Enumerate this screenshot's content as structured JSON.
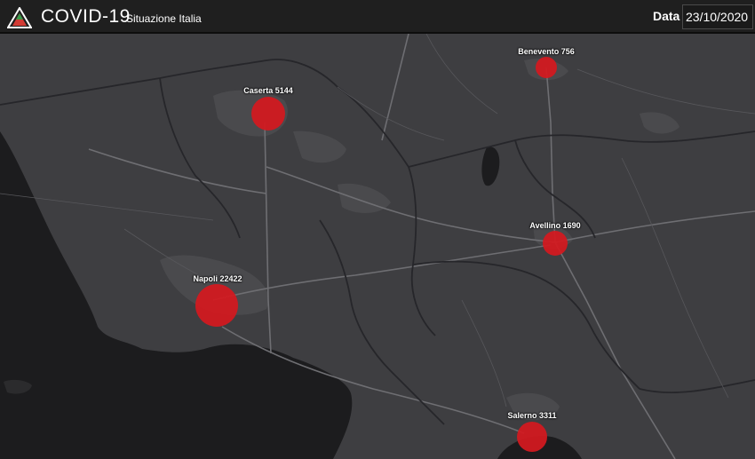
{
  "header": {
    "title": "COVID-19",
    "subtitle": "Situazione Italia",
    "date_label": "Data",
    "date_value": "23/10/2020"
  },
  "colors": {
    "marker": "#d4191f",
    "land": "#3e3e41",
    "sea": "#1c1c1e"
  },
  "markers": [
    {
      "id": "caserta",
      "label": "Caserta 5144",
      "cases": 5144
    },
    {
      "id": "benevento",
      "label": "Benevento 756",
      "cases": 756
    },
    {
      "id": "avellino",
      "label": "Avellino 1690",
      "cases": 1690
    },
    {
      "id": "napoli",
      "label": "Napoli 22422",
      "cases": 22422
    },
    {
      "id": "salerno",
      "label": "Salerno 3311",
      "cases": 3311
    }
  ]
}
